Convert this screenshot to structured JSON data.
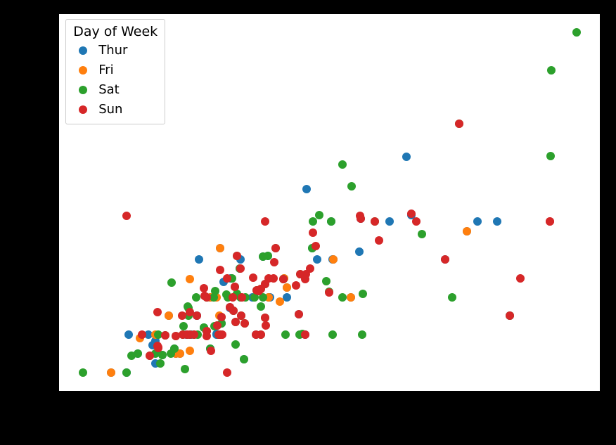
{
  "chart_data": {
    "type": "scatter",
    "xlabel": "",
    "ylabel": "",
    "title": "",
    "xlim": [
      0.7,
      53.1
    ],
    "ylim": [
      0.5,
      10.5
    ],
    "legend": {
      "title": "Day of Week",
      "position": "upper-left"
    },
    "colors": {
      "Thur": "#1f77b4",
      "Fri": "#ff7f0e",
      "Sat": "#2ca02c",
      "Sun": "#d62728"
    },
    "series": [
      {
        "name": "Thur",
        "points": [
          {
            "x": 27.2,
            "y": 4.0
          },
          {
            "x": 22.76,
            "y": 3.0
          },
          {
            "x": 17.29,
            "y": 2.71
          },
          {
            "x": 19.44,
            "y": 3.0
          },
          {
            "x": 16.66,
            "y": 3.4
          },
          {
            "x": 10.07,
            "y": 1.83
          },
          {
            "x": 32.68,
            "y": 5.0
          },
          {
            "x": 15.98,
            "y": 2.03
          },
          {
            "x": 34.83,
            "y": 5.17
          },
          {
            "x": 13.03,
            "y": 2.0
          },
          {
            "x": 18.28,
            "y": 4.0
          },
          {
            "x": 24.71,
            "y": 5.85
          },
          {
            "x": 21.16,
            "y": 3.0
          },
          {
            "x": 28.97,
            "y": 3.0
          },
          {
            "x": 22.49,
            "y": 3.5
          },
          {
            "x": 5.75,
            "y": 1.0
          },
          {
            "x": 16.32,
            "y": 4.3
          },
          {
            "x": 22.75,
            "y": 3.25
          },
          {
            "x": 40.17,
            "y": 4.73
          },
          {
            "x": 27.28,
            "y": 4.0
          },
          {
            "x": 12.03,
            "y": 1.5
          },
          {
            "x": 21.01,
            "y": 3.0
          },
          {
            "x": 12.46,
            "y": 1.5
          },
          {
            "x": 11.35,
            "y": 2.5
          },
          {
            "x": 15.38,
            "y": 3.0
          },
          {
            "x": 44.3,
            "y": 2.5
          },
          {
            "x": 22.42,
            "y": 3.48
          },
          {
            "x": 20.92,
            "y": 4.08
          },
          {
            "x": 15.36,
            "y": 1.64
          },
          {
            "x": 20.49,
            "y": 4.06
          },
          {
            "x": 25.21,
            "y": 4.29
          },
          {
            "x": 18.24,
            "y": 3.76
          },
          {
            "x": 14.31,
            "y": 4.0
          },
          {
            "x": 14.07,
            "y": 2.5
          },
          {
            "x": 7.25,
            "y": 1.0
          },
          {
            "x": 38.07,
            "y": 4.0
          },
          {
            "x": 23.95,
            "y": 2.55
          },
          {
            "x": 25.71,
            "y": 4.0
          },
          {
            "x": 17.31,
            "y": 3.5
          },
          {
            "x": 29.93,
            "y": 5.07
          },
          {
            "x": 10.77,
            "y": 1.47
          },
          {
            "x": 14.73,
            "y": 2.2
          },
          {
            "x": 10.07,
            "y": 1.25
          },
          {
            "x": 34.3,
            "y": 6.7
          },
          {
            "x": 41.19,
            "y": 5.0
          },
          {
            "x": 9.39,
            "y": 2.0
          },
          {
            "x": 27.05,
            "y": 5.0
          },
          {
            "x": 16.43,
            "y": 2.3
          },
          {
            "x": 8.35,
            "y": 1.5
          },
          {
            "x": 18.64,
            "y": 1.36
          },
          {
            "x": 11.87,
            "y": 1.63
          },
          {
            "x": 29.8,
            "y": 4.2
          },
          {
            "x": 9.78,
            "y": 1.73
          },
          {
            "x": 7.51,
            "y": 2.0
          },
          {
            "x": 14.07,
            "y": 2.5
          },
          {
            "x": 13.13,
            "y": 2.0
          },
          {
            "x": 17.26,
            "y": 2.74
          },
          {
            "x": 24.55,
            "y": 2.0
          },
          {
            "x": 19.77,
            "y": 2.0
          },
          {
            "x": 16.0,
            "y": 2.0
          },
          {
            "x": 13.51,
            "y": 2.0
          },
          {
            "x": 43.11,
            "y": 5.0
          }
        ]
      },
      {
        "name": "Fri",
        "points": [
          {
            "x": 28.97,
            "y": 3.0
          },
          {
            "x": 22.49,
            "y": 3.5
          },
          {
            "x": 5.75,
            "y": 1.0
          },
          {
            "x": 16.32,
            "y": 4.3
          },
          {
            "x": 22.75,
            "y": 3.25
          },
          {
            "x": 40.17,
            "y": 4.73
          },
          {
            "x": 27.28,
            "y": 4.0
          },
          {
            "x": 12.03,
            "y": 1.5
          },
          {
            "x": 21.01,
            "y": 3.0
          },
          {
            "x": 12.46,
            "y": 1.5
          },
          {
            "x": 11.35,
            "y": 2.5
          },
          {
            "x": 15.38,
            "y": 3.0
          },
          {
            "x": 13.42,
            "y": 3.48
          },
          {
            "x": 8.58,
            "y": 1.92
          },
          {
            "x": 15.98,
            "y": 3.0
          },
          {
            "x": 13.42,
            "y": 1.58
          },
          {
            "x": 16.27,
            "y": 2.5
          },
          {
            "x": 10.09,
            "y": 2.0
          },
          {
            "x": 22.12,
            "y": 2.88
          }
        ]
      },
      {
        "name": "Sat",
        "points": [
          {
            "x": 20.65,
            "y": 3.35
          },
          {
            "x": 17.92,
            "y": 4.08
          },
          {
            "x": 20.29,
            "y": 2.75
          },
          {
            "x": 15.77,
            "y": 2.23
          },
          {
            "x": 39.42,
            "y": 7.58
          },
          {
            "x": 19.82,
            "y": 3.18
          },
          {
            "x": 17.81,
            "y": 2.34
          },
          {
            "x": 13.37,
            "y": 2.0
          },
          {
            "x": 12.69,
            "y": 2.0
          },
          {
            "x": 21.7,
            "y": 4.3
          },
          {
            "x": 19.65,
            "y": 3.0
          },
          {
            "x": 9.55,
            "y": 1.45
          },
          {
            "x": 18.35,
            "y": 2.5
          },
          {
            "x": 15.06,
            "y": 3.0
          },
          {
            "x": 20.69,
            "y": 2.45
          },
          {
            "x": 17.78,
            "y": 3.27
          },
          {
            "x": 24.06,
            "y": 3.6
          },
          {
            "x": 16.31,
            "y": 2.0
          },
          {
            "x": 16.93,
            "y": 3.07
          },
          {
            "x": 18.69,
            "y": 2.31
          },
          {
            "x": 31.27,
            "y": 5.0
          },
          {
            "x": 16.04,
            "y": 2.24
          },
          {
            "x": 26.86,
            "y": 3.14
          },
          {
            "x": 25.28,
            "y": 5.0
          },
          {
            "x": 14.73,
            "y": 2.2
          },
          {
            "x": 10.51,
            "y": 1.25
          },
          {
            "x": 17.92,
            "y": 3.08
          },
          {
            "x": 44.3,
            "y": 2.5
          },
          {
            "x": 22.42,
            "y": 3.48
          },
          {
            "x": 20.92,
            "y": 4.08
          },
          {
            "x": 15.36,
            "y": 1.64
          },
          {
            "x": 20.49,
            "y": 4.06
          },
          {
            "x": 25.21,
            "y": 4.29
          },
          {
            "x": 18.24,
            "y": 3.76
          },
          {
            "x": 14.0,
            "y": 3.0
          },
          {
            "x": 7.25,
            "y": 1.0
          },
          {
            "x": 48.27,
            "y": 6.73
          },
          {
            "x": 20.29,
            "y": 3.21
          },
          {
            "x": 13.81,
            "y": 2.0
          },
          {
            "x": 11.02,
            "y": 1.98
          },
          {
            "x": 18.29,
            "y": 3.0
          },
          {
            "x": 17.59,
            "y": 2.64
          },
          {
            "x": 20.08,
            "y": 3.15
          },
          {
            "x": 16.45,
            "y": 2.47
          },
          {
            "x": 3.07,
            "y": 1.0
          },
          {
            "x": 20.23,
            "y": 2.01
          },
          {
            "x": 15.01,
            "y": 2.09
          },
          {
            "x": 12.02,
            "y": 1.97
          },
          {
            "x": 17.07,
            "y": 3.0
          },
          {
            "x": 14.73,
            "y": 2.2
          },
          {
            "x": 16.21,
            "y": 2.0
          },
          {
            "x": 50.81,
            "y": 10.0
          },
          {
            "x": 15.81,
            "y": 3.16
          },
          {
            "x": 26.59,
            "y": 3.41
          },
          {
            "x": 38.73,
            "y": 3.0
          },
          {
            "x": 24.27,
            "y": 2.03
          },
          {
            "x": 12.76,
            "y": 2.23
          },
          {
            "x": 30.06,
            "y": 2.0
          },
          {
            "x": 25.89,
            "y": 5.16
          },
          {
            "x": 48.33,
            "y": 9.0
          },
          {
            "x": 13.27,
            "y": 2.5
          },
          {
            "x": 28.17,
            "y": 6.5
          },
          {
            "x": 12.9,
            "y": 1.1
          },
          {
            "x": 28.15,
            "y": 3.0
          },
          {
            "x": 11.59,
            "y": 1.5
          },
          {
            "x": 7.74,
            "y": 1.44
          },
          {
            "x": 30.14,
            "y": 3.09
          },
          {
            "x": 20.45,
            "y": 3.0
          },
          {
            "x": 13.28,
            "y": 2.72
          },
          {
            "x": 24.01,
            "y": 2.0
          },
          {
            "x": 15.69,
            "y": 3.0
          },
          {
            "x": 11.61,
            "y": 3.39
          },
          {
            "x": 10.77,
            "y": 1.47
          },
          {
            "x": 10.07,
            "y": 1.5
          },
          {
            "x": 35.83,
            "y": 4.67
          },
          {
            "x": 29.03,
            "y": 5.92
          },
          {
            "x": 27.18,
            "y": 2.0
          },
          {
            "x": 22.67,
            "y": 2.0
          },
          {
            "x": 17.82,
            "y": 1.75
          },
          {
            "x": 18.78,
            "y": 3.0
          },
          {
            "x": 10.33,
            "y": 2.0
          },
          {
            "x": 14.15,
            "y": 2.0
          },
          {
            "x": 13.16,
            "y": 2.75
          },
          {
            "x": 17.47,
            "y": 3.5
          },
          {
            "x": 27.05,
            "y": 5.0
          },
          {
            "x": 16.43,
            "y": 2.3
          },
          {
            "x": 8.35,
            "y": 1.5
          },
          {
            "x": 18.64,
            "y": 1.36
          },
          {
            "x": 11.87,
            "y": 1.63
          }
        ]
      },
      {
        "name": "Sun",
        "points": [
          {
            "x": 16.99,
            "y": 1.01
          },
          {
            "x": 10.34,
            "y": 1.66
          },
          {
            "x": 21.01,
            "y": 3.5
          },
          {
            "x": 23.68,
            "y": 3.31
          },
          {
            "x": 24.59,
            "y": 3.61
          },
          {
            "x": 25.29,
            "y": 4.71
          },
          {
            "x": 8.77,
            "y": 2.0
          },
          {
            "x": 26.88,
            "y": 3.12
          },
          {
            "x": 15.04,
            "y": 1.96
          },
          {
            "x": 14.78,
            "y": 3.23
          },
          {
            "x": 10.27,
            "y": 1.71
          },
          {
            "x": 35.26,
            "y": 5.0
          },
          {
            "x": 15.42,
            "y": 1.57
          },
          {
            "x": 18.43,
            "y": 3.0
          },
          {
            "x": 14.83,
            "y": 3.02
          },
          {
            "x": 21.58,
            "y": 3.92
          },
          {
            "x": 10.33,
            "y": 1.67
          },
          {
            "x": 16.29,
            "y": 3.71
          },
          {
            "x": 16.97,
            "y": 3.5
          },
          {
            "x": 20.65,
            "y": 3.35
          },
          {
            "x": 17.92,
            "y": 4.08
          },
          {
            "x": 39.42,
            "y": 7.58
          },
          {
            "x": 19.82,
            "y": 3.18
          },
          {
            "x": 17.81,
            "y": 2.34
          },
          {
            "x": 13.37,
            "y": 2.0
          },
          {
            "x": 12.69,
            "y": 2.0
          },
          {
            "x": 21.7,
            "y": 4.3
          },
          {
            "x": 9.55,
            "y": 1.45
          },
          {
            "x": 18.35,
            "y": 2.5
          },
          {
            "x": 15.06,
            "y": 3.0
          },
          {
            "x": 20.69,
            "y": 2.45
          },
          {
            "x": 17.78,
            "y": 3.27
          },
          {
            "x": 24.06,
            "y": 3.6
          },
          {
            "x": 16.31,
            "y": 2.0
          },
          {
            "x": 18.69,
            "y": 2.31
          },
          {
            "x": 31.27,
            "y": 5.0
          },
          {
            "x": 16.04,
            "y": 2.24
          },
          {
            "x": 48.17,
            "y": 5.0
          },
          {
            "x": 20.29,
            "y": 3.21
          },
          {
            "x": 13.81,
            "y": 2.0
          },
          {
            "x": 11.02,
            "y": 1.98
          },
          {
            "x": 18.29,
            "y": 3.76
          },
          {
            "x": 17.59,
            "y": 2.64
          },
          {
            "x": 20.08,
            "y": 3.15
          },
          {
            "x": 16.45,
            "y": 2.47
          },
          {
            "x": 20.23,
            "y": 2.01
          },
          {
            "x": 15.01,
            "y": 2.09
          },
          {
            "x": 12.02,
            "y": 1.97
          },
          {
            "x": 10.29,
            "y": 2.6
          },
          {
            "x": 34.81,
            "y": 5.2
          },
          {
            "x": 25.56,
            "y": 4.34
          },
          {
            "x": 19.49,
            "y": 3.51
          },
          {
            "x": 38.07,
            "y": 4.0
          },
          {
            "x": 23.95,
            "y": 2.55
          },
          {
            "x": 29.93,
            "y": 5.07
          },
          {
            "x": 14.07,
            "y": 2.5
          },
          {
            "x": 13.13,
            "y": 2.0
          },
          {
            "x": 17.26,
            "y": 2.74
          },
          {
            "x": 24.55,
            "y": 2.0
          },
          {
            "x": 19.77,
            "y": 2.0
          },
          {
            "x": 29.85,
            "y": 5.14
          },
          {
            "x": 48.17,
            "y": 5.0
          },
          {
            "x": 25.0,
            "y": 3.75
          },
          {
            "x": 13.39,
            "y": 2.61
          },
          {
            "x": 16.49,
            "y": 2.0
          },
          {
            "x": 21.5,
            "y": 3.5
          },
          {
            "x": 12.66,
            "y": 2.5
          },
          {
            "x": 16.21,
            "y": 2.0
          },
          {
            "x": 17.51,
            "y": 3.0
          },
          {
            "x": 24.52,
            "y": 3.48
          },
          {
            "x": 20.76,
            "y": 2.24
          },
          {
            "x": 31.71,
            "y": 4.5
          },
          {
            "x": 20.69,
            "y": 5.0
          },
          {
            "x": 7.25,
            "y": 5.15
          },
          {
            "x": 44.3,
            "y": 2.5
          },
          {
            "x": 22.42,
            "y": 3.48
          },
          {
            "x": 45.35,
            "y": 3.5
          }
        ]
      }
    ]
  }
}
